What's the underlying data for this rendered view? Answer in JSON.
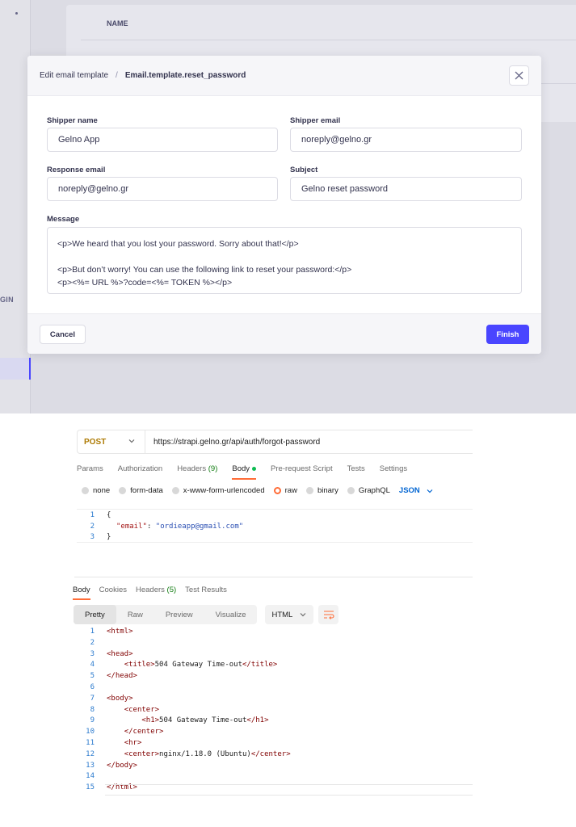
{
  "strapi": {
    "table_header": "NAME",
    "sidebar_partial": "GIN",
    "modal": {
      "breadcrumb_parent": "Edit email template",
      "breadcrumb_separator": "/",
      "breadcrumb_current": "Email.template.reset_password",
      "fields": {
        "shipper_name": {
          "label": "Shipper name",
          "value": "Gelno App"
        },
        "shipper_email": {
          "label": "Shipper email",
          "value": "noreply@gelno.gr"
        },
        "response_email": {
          "label": "Response email",
          "value": "noreply@gelno.gr"
        },
        "subject": {
          "label": "Subject",
          "value": "Gelno reset password"
        }
      },
      "message": {
        "label": "Message",
        "lines": [
          "<p>We heard that you lost your password. Sorry about that!</p>",
          "",
          "<p>But don’t worry! You can use the following link to reset your password:</p>",
          "<p><%= URL %>?code=<%= TOKEN %></p>"
        ]
      },
      "cancel_label": "Cancel",
      "finish_label": "Finish"
    }
  },
  "postman": {
    "method": "POST",
    "url": "https://strapi.gelno.gr/api/auth/forgot-password",
    "request_tabs": {
      "params": "Params",
      "authorization": "Authorization",
      "headers": "Headers",
      "headers_count": "(9)",
      "body": "Body",
      "pre_request": "Pre-request Script",
      "tests": "Tests",
      "settings": "Settings"
    },
    "body_types": {
      "none": "none",
      "form_data": "form-data",
      "urlencoded": "x-www-form-urlencoded",
      "raw": "raw",
      "binary": "binary",
      "graphql": "GraphQL",
      "format": "JSON"
    },
    "request_body": {
      "line_numbers": [
        "1",
        "2",
        "3"
      ],
      "open_brace": "{",
      "key": "\"email\"",
      "colon": ": ",
      "value": "\"ordieapp@gmail.com\"",
      "close_brace": "}"
    },
    "response_tabs": {
      "body": "Body",
      "cookies": "Cookies",
      "headers": "Headers",
      "headers_count": "(5)",
      "test_results": "Test Results"
    },
    "view_modes": {
      "pretty": "Pretty",
      "raw": "Raw",
      "preview": "Preview",
      "visualize": "Visualize",
      "format": "HTML"
    },
    "response_body": [
      {
        "n": "1",
        "text": "<html>"
      },
      {
        "n": "2",
        "text": ""
      },
      {
        "n": "3",
        "text": "<head>"
      },
      {
        "n": "4",
        "text": "    <title>504 Gateway Time-out</title>"
      },
      {
        "n": "5",
        "text": "</head>"
      },
      {
        "n": "6",
        "text": ""
      },
      {
        "n": "7",
        "text": "<body>"
      },
      {
        "n": "8",
        "text": "    <center>"
      },
      {
        "n": "9",
        "text": "        <h1>504 Gateway Time-out</h1>"
      },
      {
        "n": "10",
        "text": "    </center>"
      },
      {
        "n": "11",
        "text": "    <hr>"
      },
      {
        "n": "12",
        "text": "    <center>nginx/1.18.0 (Ubuntu)</center>"
      },
      {
        "n": "13",
        "text": "</body>"
      },
      {
        "n": "14",
        "text": ""
      },
      {
        "n": "15",
        "text": "</html>"
      }
    ]
  }
}
